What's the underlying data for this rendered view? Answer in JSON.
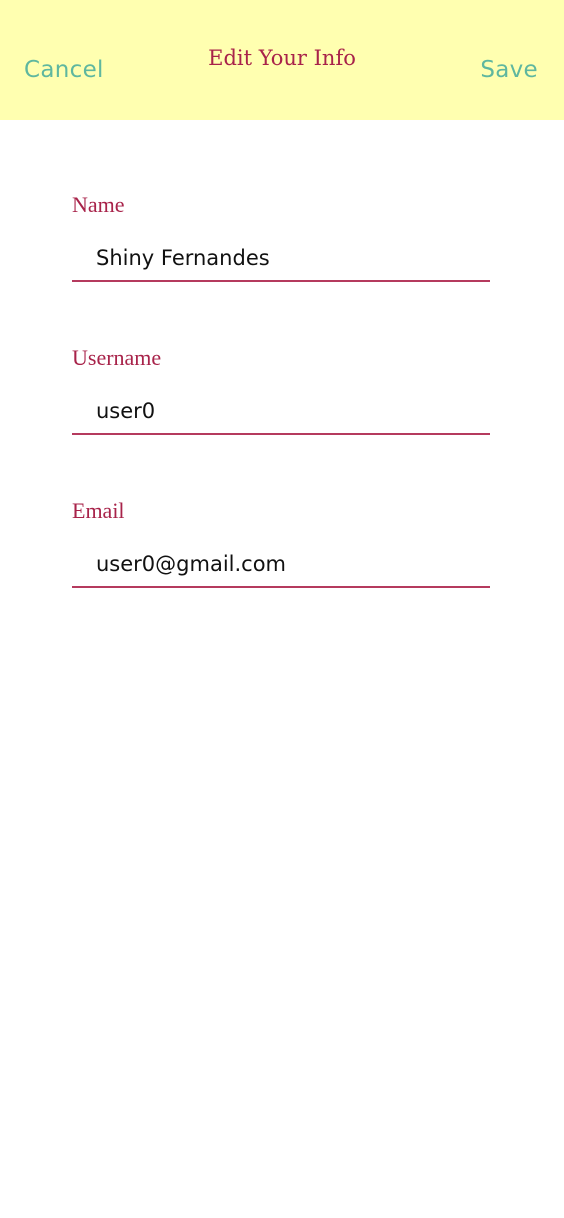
{
  "header": {
    "cancel_label": "Cancel",
    "title": "Edit Your Info",
    "save_label": "Save"
  },
  "form": {
    "fields": [
      {
        "label": "Name",
        "value": "Shiny Fernandes"
      },
      {
        "label": "Username",
        "value": "user0"
      },
      {
        "label": "Email",
        "value": "user0@gmail.com"
      }
    ]
  },
  "colors": {
    "header_bg": "#ffffb0",
    "accent_teal": "#5fb79f",
    "accent_crimson": "#a8234a"
  }
}
